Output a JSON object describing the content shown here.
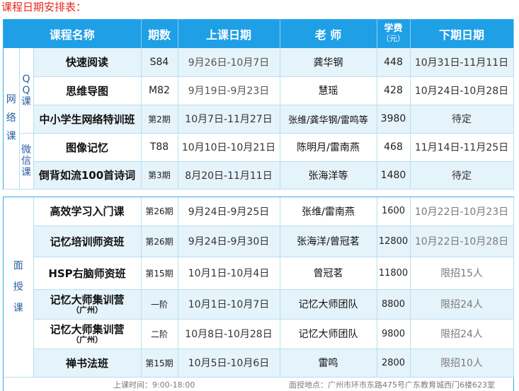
{
  "page_title": "课程日期安排表：",
  "headers": {
    "name": "课程名称",
    "period": "期数",
    "dates": "上课日期",
    "teacher": "老 师",
    "fee": "学费",
    "fee_unit": "（元）",
    "next": "下期日期"
  },
  "groups": {
    "online": "网络课",
    "qq": "QQ课",
    "wechat": "微信课",
    "offline": "面授课"
  },
  "section1": [
    {
      "name": "快速阅读",
      "period": "S84",
      "dates": "9月26日-10月7日",
      "teacher": "龚华钢",
      "fee": "448",
      "next": "10月31日-11月11日"
    },
    {
      "name": "思维导图",
      "period": "M82",
      "dates": "9月19日-9月23日",
      "teacher": "慧瑶",
      "fee": "428",
      "next": "10月24日-10月28日"
    },
    {
      "name": "中小学生网络特训班",
      "period": "第2期",
      "dates": "10月7日-11月27日",
      "teacher": "张维/龚华钢/雷鸣等",
      "fee": "3980",
      "next": "待定"
    },
    {
      "name": "图像记忆",
      "period": "T88",
      "dates": "10月10日-10月21日",
      "teacher": "陈明月/雷南燕",
      "fee": "468",
      "next": "11月14日-11月25日"
    },
    {
      "name": "倒背如流100首诗词",
      "period": "第3期",
      "dates": "8月20日-11月11日",
      "teacher": "张海洋等",
      "fee": "1480",
      "next": "待定"
    }
  ],
  "section2": [
    {
      "name": "高效学习入门课",
      "sub": "",
      "period": "第26期",
      "dates": "9月24日-9月25日",
      "teacher": "张维/雷南燕",
      "fee": "1600",
      "next": "10月22日-10月23日"
    },
    {
      "name": "记忆培训师资班",
      "sub": "",
      "period": "第26期",
      "dates": "9月24日-9月30日",
      "teacher": "张海洋/曾冠茗",
      "fee": "12800",
      "next": "10月22日-10月28日"
    },
    {
      "name": "HSP右脑师资班",
      "sub": "",
      "period": "第15期",
      "dates": "10月1日-10月4日",
      "teacher": "曾冠茗",
      "fee": "11800",
      "next": "限招15人"
    },
    {
      "name": "记忆大师集训营",
      "sub": "（广州）",
      "period": "一阶",
      "dates": "10月1日-10月7日",
      "teacher": "记忆大师团队",
      "fee": "8800",
      "next": "限招24人"
    },
    {
      "name": "记忆大师集训营",
      "sub": "（广州）",
      "period": "二阶",
      "dates": "10月8日-10月28日",
      "teacher": "记忆大师团队",
      "fee": "9800",
      "next": "限招24人"
    },
    {
      "name": "禅书法班",
      "sub": "",
      "period": "第15期",
      "dates": "10月5日-10月6日",
      "teacher": "雷鸣",
      "fee": "2800",
      "next": "限招10人"
    }
  ],
  "footer": {
    "time": "上课时间：9:00-18:00",
    "address": "面授地点：广州市环市东路475号广东教育城西门6楼623室"
  }
}
